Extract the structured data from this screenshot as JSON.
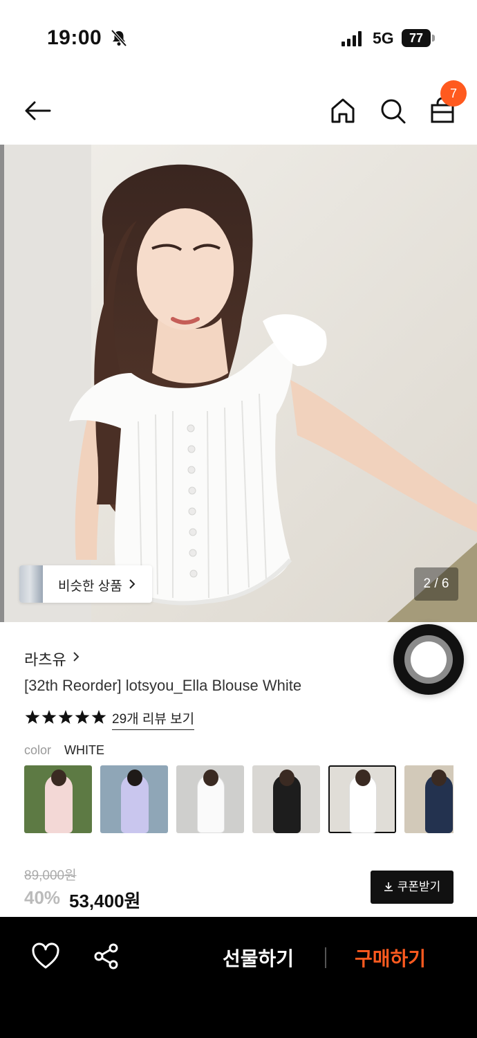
{
  "status_bar": {
    "time": "19:00",
    "network": "5G",
    "battery": "77"
  },
  "header": {
    "cart_count": "7"
  },
  "gallery": {
    "similar_label": "비슷한 상품",
    "pager": "2 / 6"
  },
  "product": {
    "brand": "라츠유",
    "title": "[32th Reorder] lotsyou_Ella Blouse White",
    "rating_stars": 5,
    "review_link": "29개 리뷰 보기",
    "color_label": "color",
    "color_value": "WHITE",
    "original_price": "89,000원",
    "discount": "40%",
    "sale_price": "53,400원",
    "coupon_label": "쿠폰받기"
  },
  "bottom_bar": {
    "gift_label": "선물하기",
    "buy_label": "구매하기"
  },
  "colors": {
    "accent": "#ff5a1f",
    "bar": "#000000"
  }
}
